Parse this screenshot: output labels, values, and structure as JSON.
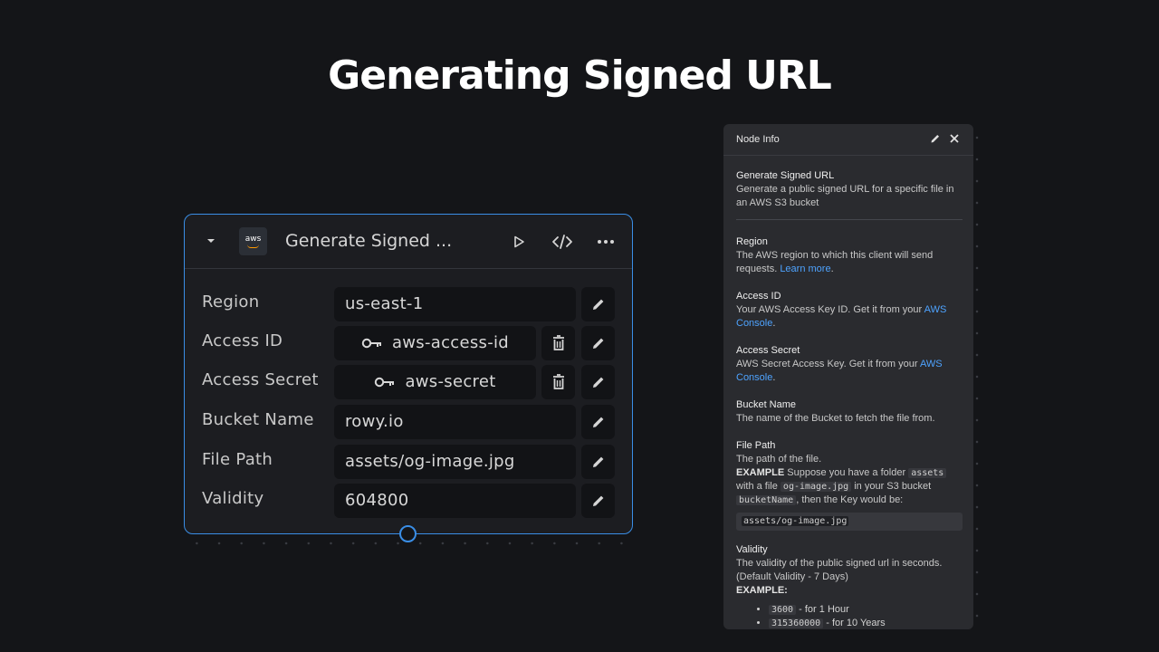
{
  "slide": {
    "title": "Generating Signed URL"
  },
  "node": {
    "title": "Generate Signed ...",
    "logo_text": "aws",
    "fields": [
      {
        "label": "Region",
        "value": "us-east-1",
        "kind": "text"
      },
      {
        "label": "Access ID",
        "value": "aws-access-id",
        "kind": "secret"
      },
      {
        "label": "Access Secret",
        "value": "aws-secret",
        "kind": "secret"
      },
      {
        "label": "Bucket Name",
        "value": "rowy.io",
        "kind": "text"
      },
      {
        "label": "File Path",
        "value": "assets/og-image.jpg",
        "kind": "text"
      },
      {
        "label": "Validity",
        "value": "604800",
        "kind": "text"
      }
    ],
    "accent_color": "#3a8ee6"
  },
  "panel": {
    "title": "Node Info",
    "intro": {
      "heading": "Generate Signed URL",
      "text": "Generate a public signed URL for a specific file in an AWS S3 bucket"
    },
    "region": {
      "heading": "Region",
      "text": "The AWS region to which this client will send requests.",
      "link": "Learn more"
    },
    "access_id": {
      "heading": "Access ID",
      "text": "Your AWS Access Key ID. Get it from your",
      "link": "AWS Console"
    },
    "access_secret": {
      "heading": "Access Secret",
      "text": "AWS Secret Access Key. Get it from your",
      "link": "AWS Console"
    },
    "bucket": {
      "heading": "Bucket Name",
      "text": "The name of the Bucket to fetch the file from."
    },
    "file_path": {
      "heading": "File Path",
      "text": "The path of the file.",
      "example_label": "EXAMPLE",
      "example_1": "Suppose you have a folder",
      "code_1": "assets",
      "example_2": "with a file",
      "code_2": "og-image.jpg",
      "example_3": "in your S3 bucket",
      "code_3": "bucketName",
      "example_4": ", then the Key would be:",
      "code_block": "assets/og-image.jpg"
    },
    "validity": {
      "heading": "Validity",
      "text": "The validity of the public signed url in seconds. (Default Validity - 7 Days)",
      "example_label": "EXAMPLE:",
      "items": [
        {
          "code": "3600",
          "text": "- for 1 Hour"
        },
        {
          "code": "315360000",
          "text": "- for 10 Years"
        }
      ]
    }
  }
}
